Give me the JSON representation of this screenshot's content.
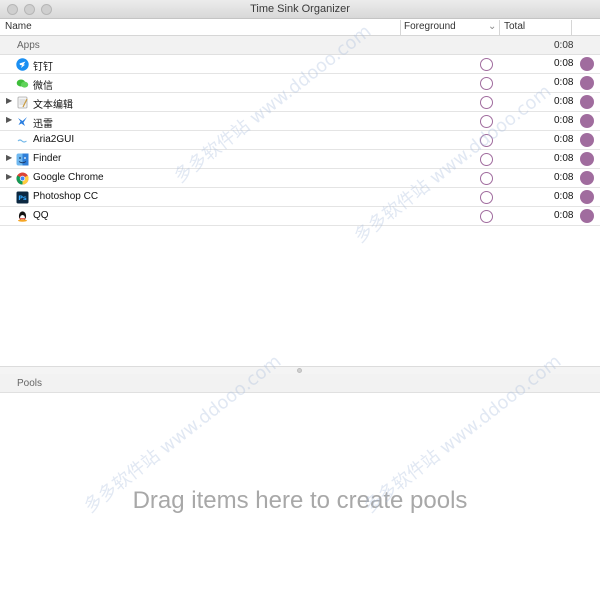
{
  "window": {
    "title": "Time Sink Organizer"
  },
  "columns": {
    "name": "Name",
    "foreground": "Foreground",
    "total": "Total"
  },
  "apps_group": {
    "title": "Apps",
    "total": "0:08"
  },
  "apps": [
    {
      "name": "钉钉",
      "icon": "dingtalk-icon",
      "has_children": false,
      "total": "0:08"
    },
    {
      "name": "微信",
      "icon": "wechat-icon",
      "has_children": false,
      "total": "0:08"
    },
    {
      "name": "文本编辑",
      "icon": "textedit-icon",
      "has_children": true,
      "total": "0:08"
    },
    {
      "name": "迅雷",
      "icon": "xunlei-icon",
      "has_children": true,
      "total": "0:08"
    },
    {
      "name": "Aria2GUI",
      "icon": "aria2gui-icon",
      "has_children": false,
      "total": "0:08"
    },
    {
      "name": "Finder",
      "icon": "finder-icon",
      "has_children": true,
      "total": "0:08"
    },
    {
      "name": "Google Chrome",
      "icon": "chrome-icon",
      "has_children": true,
      "total": "0:08"
    },
    {
      "name": "Photoshop CC",
      "icon": "photoshop-icon",
      "has_children": false,
      "total": "0:08"
    },
    {
      "name": "QQ",
      "icon": "qq-icon",
      "has_children": false,
      "total": "0:08"
    }
  ],
  "pools_group": {
    "title": "Pools"
  },
  "pools_empty_text": "Drag items here to create pools",
  "colors": {
    "accent": "#a06c9e"
  },
  "watermark": "多多软件站 www.ddooo.com"
}
